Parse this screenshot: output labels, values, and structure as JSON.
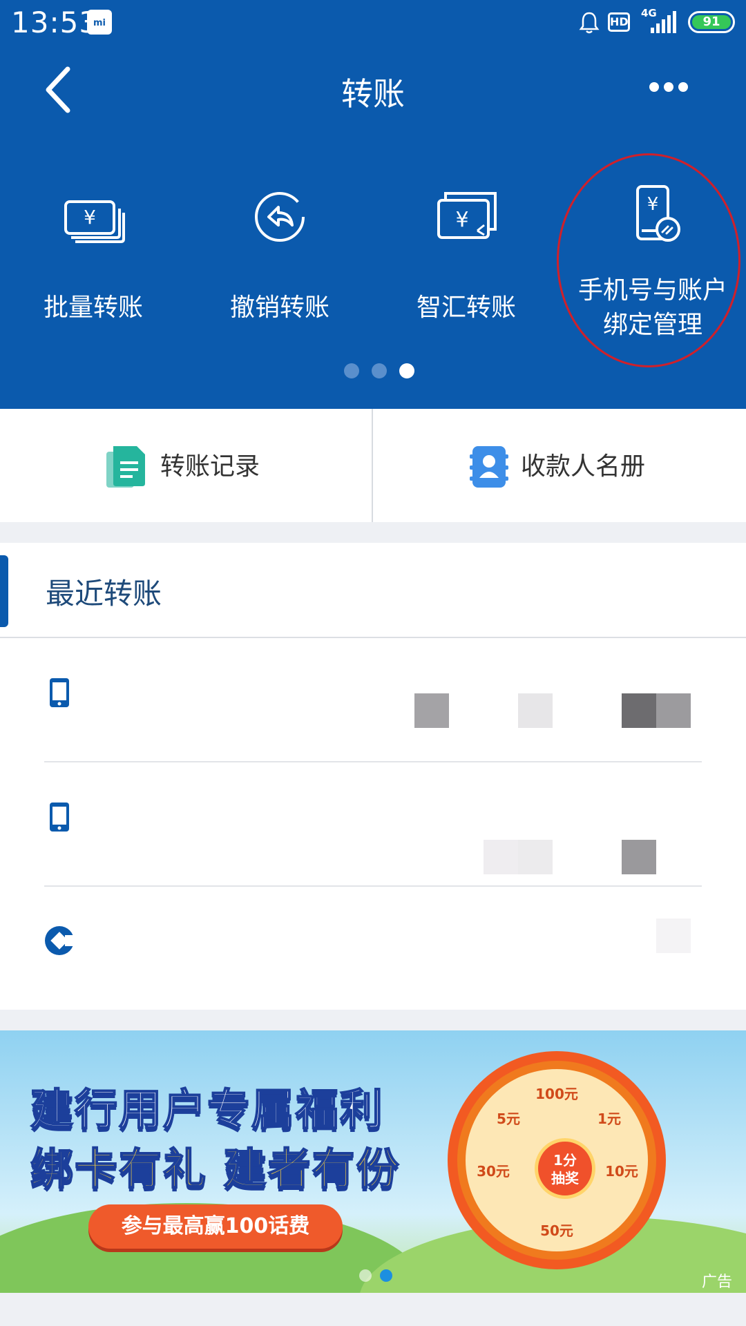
{
  "status_bar": {
    "time": "13:53",
    "mi_label": "mi",
    "hd_label": "HD",
    "network": "4G",
    "battery": "91"
  },
  "nav": {
    "title": "转账"
  },
  "quick_actions": [
    {
      "label": "批量转账",
      "icon": "yuan-bills-icon"
    },
    {
      "label": "撤销转账",
      "icon": "undo-circle-icon"
    },
    {
      "label": "智汇转账",
      "icon": "yuan-exchange-icon"
    },
    {
      "label": "手机号与账户绑定管理",
      "line1": "手机号与账户",
      "line2": "绑定管理",
      "icon": "phone-yuan-link-icon"
    }
  ],
  "pager": {
    "count": 3,
    "active": 3
  },
  "shortcuts": {
    "records": "转账记录",
    "payees": "收款人名册"
  },
  "recent": {
    "title": "最近转账"
  },
  "banner": {
    "line1": "建行用户专属福利",
    "line2": "绑卡有礼 建者有份",
    "button": "参与最高赢100话费",
    "center_line1": "1分",
    "center_line2": "抽奖",
    "prize_100": "100元",
    "prize_1": "1元",
    "prize_5": "5元",
    "prize_10": "10元",
    "prize_30": "30元",
    "prize_50": "50元",
    "ad_label": "广告"
  },
  "colors": {
    "brand_blue": "#0b5aad",
    "highlight_circle": "#d0202a"
  }
}
